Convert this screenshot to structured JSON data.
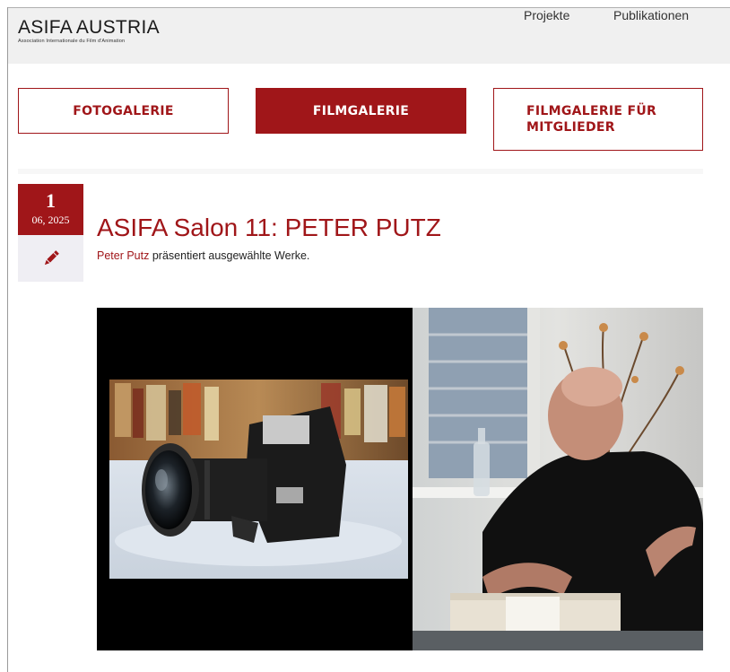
{
  "header": {
    "logo_title": "ASIFA AUSTRIA",
    "logo_subtitle": "Association Internationale du Film d'Animation",
    "nav": [
      {
        "label": "Projekte"
      },
      {
        "label": "Publikationen"
      }
    ]
  },
  "tabs": [
    {
      "label": "FOTOGALERIE",
      "active": false
    },
    {
      "label": "FILMGALERIE",
      "active": true
    },
    {
      "label": "FILMGALERIE FÜR MITGLIEDER",
      "active": false
    }
  ],
  "post": {
    "date_day": "1",
    "date_month_year": "06, 2025",
    "format_icon": "pencil-icon",
    "title": "ASIFA Salon 11: PETER PUTZ",
    "author_link": "Peter Putz",
    "excerpt_rest": " präsentiert ausgewählte Werke."
  },
  "colors": {
    "accent": "#a01619",
    "header_bg": "#f0f0f0",
    "format_box_bg": "#efeef3"
  }
}
